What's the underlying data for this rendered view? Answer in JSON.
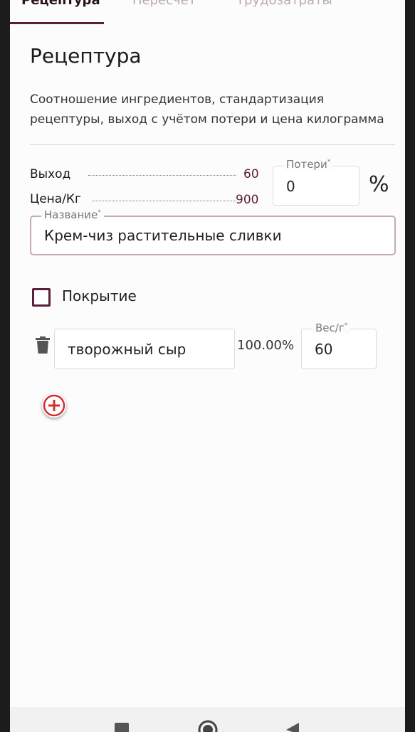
{
  "tabs": [
    {
      "label": "Рецептура",
      "active": true
    },
    {
      "label": "Пересчет",
      "active": false
    },
    {
      "label": "Трудозатраты",
      "active": false
    }
  ],
  "page": {
    "title": "Рецептура",
    "description": "Соотношение ингредиентов, стандартизация рецептуры, выход с учётом потери и цена килограмма"
  },
  "stats": {
    "yield_label": "Выход",
    "yield_value": "60",
    "price_label": "Цена/Кг",
    "price_value": "900"
  },
  "loss_field": {
    "label": "Потери",
    "required_mark": "*",
    "value": "0",
    "unit": "%"
  },
  "name_field": {
    "label": "Название",
    "required_mark": "*",
    "value": "Крем-чиз растительные сливки"
  },
  "coating": {
    "label": "Покрытие",
    "checked": false
  },
  "ingredients": [
    {
      "name": "творожный сыр",
      "percent": "100.00%",
      "weight_label": "Вес/г",
      "required_mark": "*",
      "weight": "60"
    }
  ],
  "colors": {
    "accent": "#5a1f3b",
    "add_button": "#d32f2f"
  },
  "icons": {
    "delete": "trash-icon",
    "add": "add-circle-icon",
    "nav_recent": "square-icon",
    "nav_home": "circle-icon",
    "nav_back": "triangle-icon"
  }
}
